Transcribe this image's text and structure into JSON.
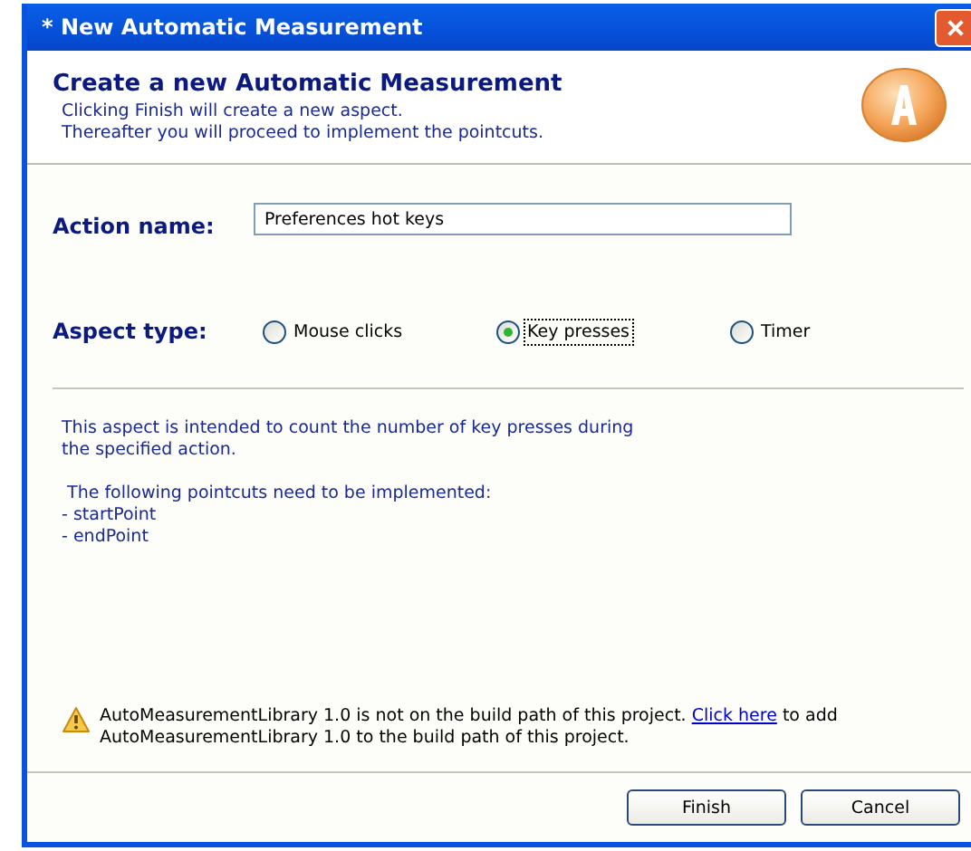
{
  "window": {
    "title": "* New Automatic Measurement"
  },
  "header": {
    "title": "Create a new Automatic Measurement",
    "description": "Clicking Finish will create a new aspect.\nThereafter you will proceed to implement the pointcuts."
  },
  "action_name": {
    "label": "Action name:",
    "value": "Preferences hot keys"
  },
  "aspect_type": {
    "label": "Aspect type:",
    "options": [
      {
        "label": "Mouse clicks",
        "selected": false
      },
      {
        "label": "Key presses",
        "selected": true
      },
      {
        "label": "Timer",
        "selected": false
      }
    ]
  },
  "description": "This aspect is intended to count the number of key presses during\nthe specified action.",
  "pointcuts": {
    "heading": " The following pointcuts need to be implemented:",
    "items": [
      "- startPoint",
      "- endPoint"
    ]
  },
  "warning": {
    "text_before": "AutoMeasurementLibrary 1.0 is not on the build path of this project.",
    "link": "Click here",
    "text_after": "to add AutoMeasurementLibrary 1.0 to the build path of this project."
  },
  "buttons": [
    "Finish",
    "Cancel"
  ]
}
